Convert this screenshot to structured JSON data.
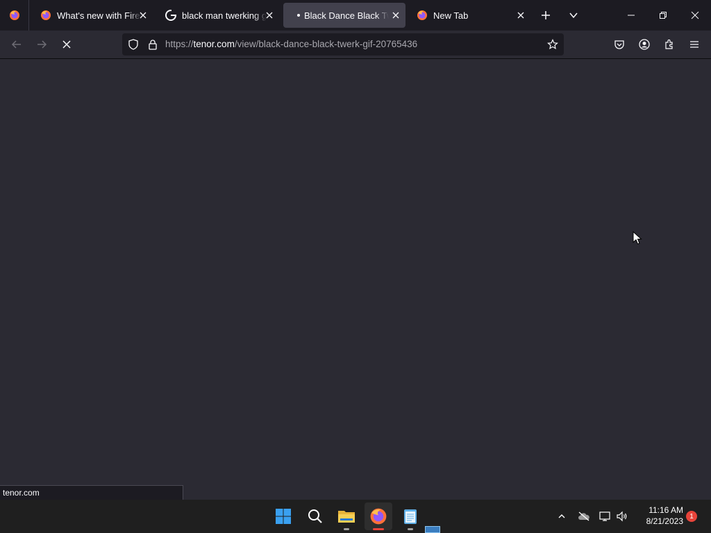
{
  "tabs": [
    {
      "title": "What's new with Firefox",
      "icon": "firefox-icon",
      "selected": false
    },
    {
      "title": "black man twerking gif",
      "icon": "google-icon",
      "selected": false
    },
    {
      "title": "Black Dance Black Twerk",
      "icon": "loading-dot",
      "selected": true
    },
    {
      "title": "New Tab",
      "icon": "firefox-icon",
      "selected": false
    }
  ],
  "navbar": {
    "url_prefix": "https://",
    "url_host": "tenor.com",
    "url_path": "/view/black-dance-black-twerk-gif-20765436"
  },
  "status": {
    "text": "tenor.com"
  },
  "taskbar": {
    "time": "11:16 AM",
    "date": "8/21/2023",
    "notifications": "1"
  },
  "colors": {
    "accent": "#e8443a",
    "content_bg": "#2b2a33",
    "tabstrip_bg": "#1c1b22"
  }
}
